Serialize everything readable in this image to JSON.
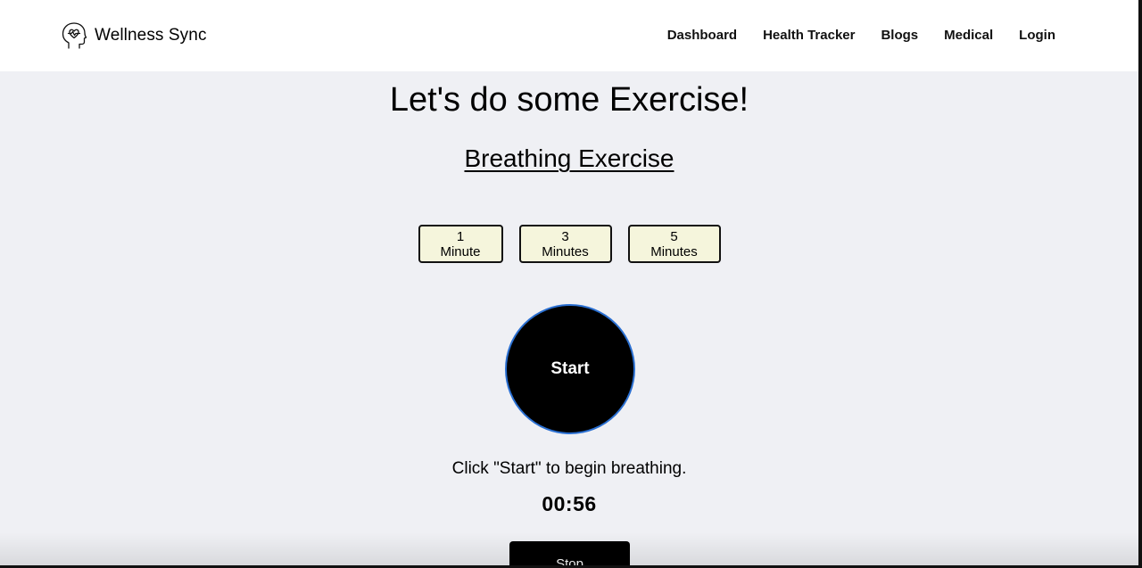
{
  "brand": {
    "name": "Wellness Sync",
    "icon": "head-heartbeat-icon"
  },
  "nav": {
    "items": [
      {
        "label": "Dashboard"
      },
      {
        "label": "Health Tracker"
      },
      {
        "label": "Blogs"
      },
      {
        "label": "Medical"
      },
      {
        "label": "Login"
      }
    ]
  },
  "main": {
    "heading": "Let's do some Exercise!",
    "subheading": "Breathing Exercise",
    "durations": [
      {
        "label": "1 Minute"
      },
      {
        "label": "3 Minutes"
      },
      {
        "label": "5 Minutes"
      }
    ],
    "start_label": "Start",
    "instruction": "Click \"Start\" to begin breathing.",
    "timer": "00:56",
    "stop_label": "Stop"
  },
  "colors": {
    "page_background": "#eff0f4",
    "duration_button_bg": "#f5f5dc",
    "circle_border": "#2a6fd1",
    "dark": "#000000"
  }
}
